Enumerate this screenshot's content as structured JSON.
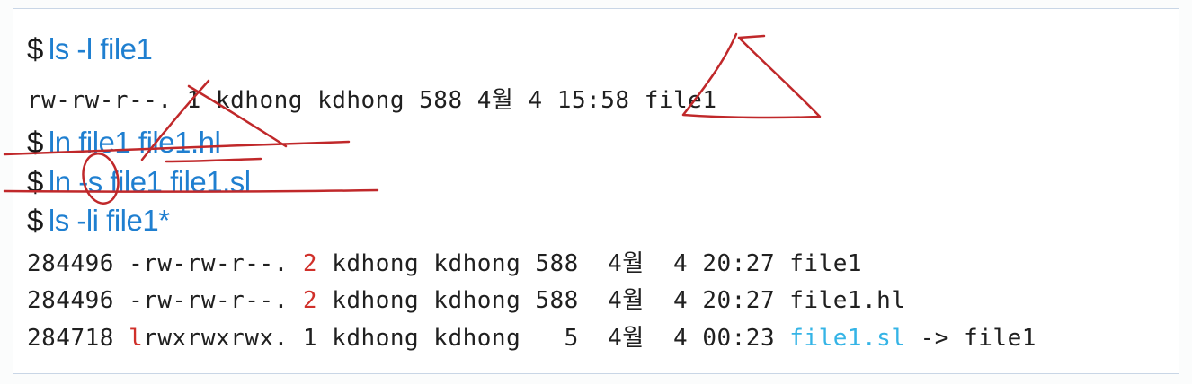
{
  "commands": {
    "cmd1": {
      "prompt": "$",
      "text": "ls -l file1"
    },
    "cmd2": {
      "prompt": "$",
      "text": "ln file1 file1.hl"
    },
    "cmd3": {
      "prompt": "$",
      "text": "ln -s file1 file1.sl"
    },
    "cmd4": {
      "prompt": "$",
      "text": "ls -li file1*"
    }
  },
  "output1": "rw-rw-r--. 1 kdhong kdhong 588 4월 4 15:58 file1",
  "listing": [
    {
      "inode": "284496 ",
      "type": "-",
      "perms": "rw-rw-r--. ",
      "links": "2",
      "rest": " kdhong kdhong 588  4월  4 20:27 ",
      "name": "file1",
      "target": ""
    },
    {
      "inode": "284496 ",
      "type": "-",
      "perms": "rw-rw-r--. ",
      "links": "2",
      "rest": " kdhong kdhong 588  4월  4 20:27 ",
      "name": "file1.hl",
      "target": ""
    },
    {
      "inode": "284718 ",
      "type": "l",
      "perms": "rwxrwxrwx. ",
      "links": "1",
      "rest": " kdhong kdhong   5  4월  4 00:23 ",
      "name": "file1.sl",
      "target": " -> file1"
    }
  ],
  "colors": {
    "command": "#1f7fd0",
    "prompt": "#1a1a1a",
    "highlight_red": "#d0302a",
    "symlink_cyan": "#35b4e6",
    "annotation": "#c0282a"
  }
}
